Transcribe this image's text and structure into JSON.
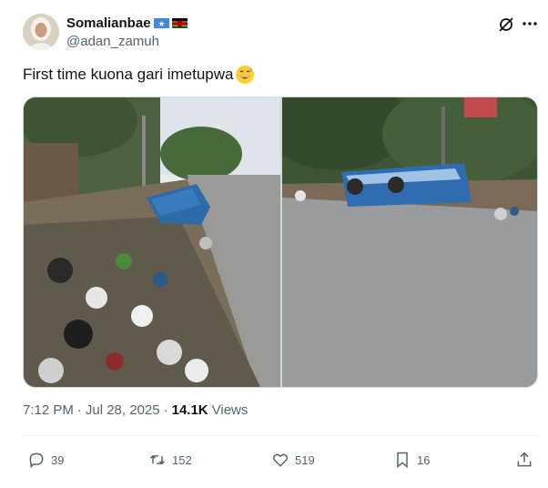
{
  "author": {
    "display_name": "Somalianbae",
    "handle": "@adan_zamuh",
    "flags": [
      "somalia-flag",
      "kenya-flag"
    ]
  },
  "tweet": {
    "text": "First time kuona gari imetupwa",
    "emoji": "grinning-face-with-sweat"
  },
  "meta": {
    "time": "7:12 PM",
    "separator": "·",
    "date": "Jul 28, 2025",
    "separator2": "·",
    "views_count": "14.1K",
    "views_label": "Views"
  },
  "actions": {
    "replies": "39",
    "reposts": "152",
    "likes": "519",
    "bookmarks": "16"
  },
  "icons": [
    "grok-icon",
    "more-icon",
    "reply-icon",
    "repost-icon",
    "like-icon",
    "bookmark-icon",
    "share-icon"
  ],
  "colors": {
    "text": "#0f1419",
    "muted": "#536471",
    "border": "#cfd9de"
  }
}
